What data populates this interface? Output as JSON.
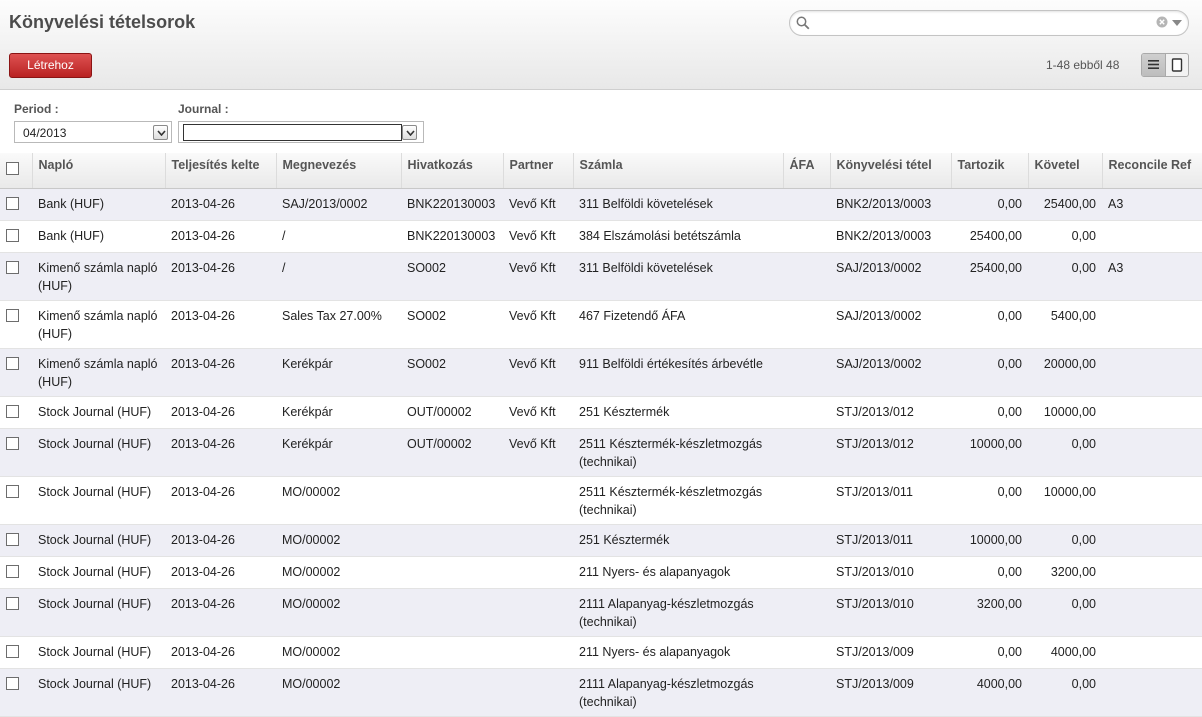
{
  "header": {
    "title": "Könyvelési tételsorok",
    "create_label": "Létrehoz",
    "pager": "1-48 ebből 48",
    "search": {
      "value": "",
      "placeholder": ""
    }
  },
  "filters": {
    "period_label": "Period :",
    "period_value": "04/2013",
    "journal_label": "Journal :",
    "journal_value": ""
  },
  "table": {
    "columns": [
      "Napló",
      "Teljesítés kelte",
      "Megnevezés",
      "Hivatkozás",
      "Partner",
      "Számla",
      "ÁFA",
      "Könyvelési tétel",
      "Tartozik",
      "Követel",
      "Reconcile Ref"
    ],
    "rows": [
      {
        "naplo": "Bank (HUF)",
        "date": "2013-04-26",
        "name": "SAJ/2013/0002",
        "ref": "BNK220130003",
        "partner": "Vevő Kft",
        "account": "311 Belföldi követelések",
        "tax": "",
        "move": "BNK2/2013/0003",
        "debit": "0,00",
        "credit": "25400,00",
        "reconcile": "A3"
      },
      {
        "naplo": "Bank (HUF)",
        "date": "2013-04-26",
        "name": "/",
        "ref": "BNK220130003",
        "partner": "Vevő Kft",
        "account": "384 Elszámolási betétszámla",
        "tax": "",
        "move": "BNK2/2013/0003",
        "debit": "25400,00",
        "credit": "0,00",
        "reconcile": ""
      },
      {
        "naplo": "Kimenő számla napló (HUF)",
        "date": "2013-04-26",
        "name": "/",
        "ref": "SO002",
        "partner": "Vevő Kft",
        "account": "311 Belföldi követelések",
        "tax": "",
        "move": "SAJ/2013/0002",
        "debit": "25400,00",
        "credit": "0,00",
        "reconcile": "A3"
      },
      {
        "naplo": "Kimenő számla napló (HUF)",
        "date": "2013-04-26",
        "name": "Sales Tax 27.00%",
        "ref": "SO002",
        "partner": "Vevő Kft",
        "account": "467 Fizetendő ÁFA",
        "tax": "",
        "move": "SAJ/2013/0002",
        "debit": "0,00",
        "credit": "5400,00",
        "reconcile": ""
      },
      {
        "naplo": "Kimenő számla napló (HUF)",
        "date": "2013-04-26",
        "name": "Kerékpár",
        "ref": "SO002",
        "partner": "Vevő Kft",
        "account": "911 Belföldi értékesítés árbevétle",
        "tax": "",
        "move": "SAJ/2013/0002",
        "debit": "0,00",
        "credit": "20000,00",
        "reconcile": ""
      },
      {
        "naplo": "Stock Journal (HUF)",
        "date": "2013-04-26",
        "name": "Kerékpár",
        "ref": "OUT/00002",
        "partner": "Vevő Kft",
        "account": "251 Késztermék",
        "tax": "",
        "move": "STJ/2013/012",
        "debit": "0,00",
        "credit": "10000,00",
        "reconcile": ""
      },
      {
        "naplo": "Stock Journal (HUF)",
        "date": "2013-04-26",
        "name": "Kerékpár",
        "ref": "OUT/00002",
        "partner": "Vevő Kft",
        "account": "2511 Késztermék-készletmozgás (technikai)",
        "tax": "",
        "move": "STJ/2013/012",
        "debit": "10000,00",
        "credit": "0,00",
        "reconcile": ""
      },
      {
        "naplo": "Stock Journal (HUF)",
        "date": "2013-04-26",
        "name": "MO/00002",
        "ref": "",
        "partner": "",
        "account": "2511 Késztermék-készletmozgás (technikai)",
        "tax": "",
        "move": "STJ/2013/011",
        "debit": "0,00",
        "credit": "10000,00",
        "reconcile": ""
      },
      {
        "naplo": "Stock Journal (HUF)",
        "date": "2013-04-26",
        "name": "MO/00002",
        "ref": "",
        "partner": "",
        "account": "251 Késztermék",
        "tax": "",
        "move": "STJ/2013/011",
        "debit": "10000,00",
        "credit": "0,00",
        "reconcile": ""
      },
      {
        "naplo": "Stock Journal (HUF)",
        "date": "2013-04-26",
        "name": "MO/00002",
        "ref": "",
        "partner": "",
        "account": "211 Nyers- és alapanyagok",
        "tax": "",
        "move": "STJ/2013/010",
        "debit": "0,00",
        "credit": "3200,00",
        "reconcile": ""
      },
      {
        "naplo": "Stock Journal (HUF)",
        "date": "2013-04-26",
        "name": "MO/00002",
        "ref": "",
        "partner": "",
        "account": "2111 Alapanyag-készletmozgás (technikai)",
        "tax": "",
        "move": "STJ/2013/010",
        "debit": "3200,00",
        "credit": "0,00",
        "reconcile": ""
      },
      {
        "naplo": "Stock Journal (HUF)",
        "date": "2013-04-26",
        "name": "MO/00002",
        "ref": "",
        "partner": "",
        "account": "211 Nyers- és alapanyagok",
        "tax": "",
        "move": "STJ/2013/009",
        "debit": "0,00",
        "credit": "4000,00",
        "reconcile": ""
      },
      {
        "naplo": "Stock Journal (HUF)",
        "date": "2013-04-26",
        "name": "MO/00002",
        "ref": "",
        "partner": "",
        "account": "2111 Alapanyag-készletmozgás (technikai)",
        "tax": "",
        "move": "STJ/2013/009",
        "debit": "4000,00",
        "credit": "0,00",
        "reconcile": ""
      }
    ]
  },
  "colors": {
    "accent": "#c62a2a",
    "row_alt": "#eeeef5"
  },
  "icons": {
    "search": "search-icon",
    "clear": "clear-icon",
    "dropdown": "chevron-down-icon",
    "list_view": "list-view-icon",
    "form_view": "form-view-icon"
  }
}
